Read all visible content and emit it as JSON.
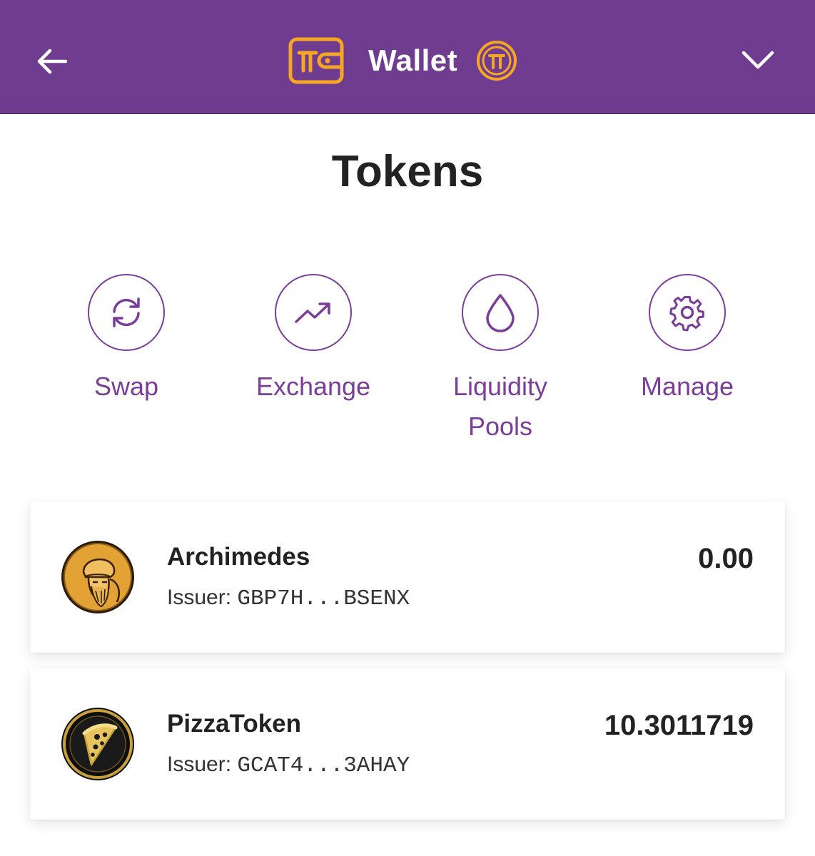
{
  "header": {
    "title": "Wallet",
    "background_color": "#703c90",
    "accent_color": "#f5a623",
    "icons": [
      "back-arrow-icon",
      "wallet-icon",
      "pi-coin-icon",
      "chevron-down-icon"
    ]
  },
  "page": {
    "title": "Tokens"
  },
  "actions": [
    {
      "label": "Swap",
      "icon": "swap-icon"
    },
    {
      "label": "Exchange",
      "icon": "trending-up-icon"
    },
    {
      "label": "Liquidity Pools",
      "icon": "droplet-icon"
    },
    {
      "label": "Manage",
      "icon": "gear-icon"
    }
  ],
  "tokens": [
    {
      "name": "Archimedes",
      "issuer_label": "Issuer:",
      "issuer": "GBP7H...BSENX",
      "balance": "0.00",
      "icon": "archimedes-logo"
    },
    {
      "name": "PizzaToken",
      "issuer_label": "Issuer:",
      "issuer": "GCAT4...3AHAY",
      "balance": "10.3011719",
      "icon": "pizza-logo"
    }
  ]
}
